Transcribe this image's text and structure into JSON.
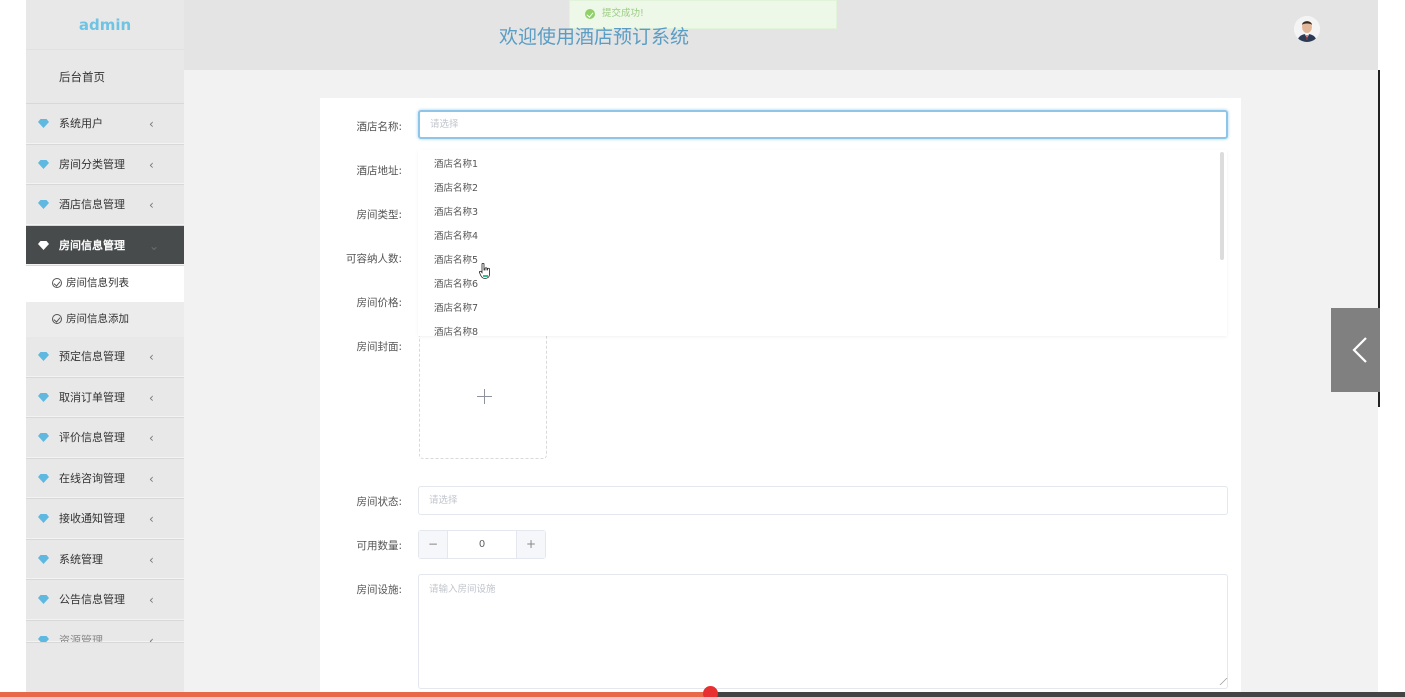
{
  "sidebar": {
    "brand": "admin",
    "home": "后台首页",
    "items": [
      {
        "label": "系统用户",
        "icon": "gem-icon"
      },
      {
        "label": "房间分类管理",
        "icon": "gem-icon"
      },
      {
        "label": "酒店信息管理",
        "icon": "gem-icon"
      },
      {
        "label": "房间信息管理",
        "icon": "gem-icon",
        "active": true
      },
      {
        "label": "预定信息管理",
        "icon": "gem-icon"
      },
      {
        "label": "取消订单管理",
        "icon": "gem-icon"
      },
      {
        "label": "评价信息管理",
        "icon": "gem-icon"
      },
      {
        "label": "在线咨询管理",
        "icon": "gem-icon"
      },
      {
        "label": "接收通知管理",
        "icon": "gem-icon"
      },
      {
        "label": "系统管理",
        "icon": "gem-icon"
      },
      {
        "label": "公告信息管理",
        "icon": "gem-icon"
      },
      {
        "label": "资源管理",
        "icon": "gem-icon"
      }
    ],
    "subitems": [
      "房间信息列表",
      "房间信息添加"
    ]
  },
  "header": {
    "title": "欢迎使用酒店预订系统",
    "toast": "提交成功!"
  },
  "form": {
    "hotel_name_label": "酒店名称:",
    "hotel_name_placeholder": "请选择",
    "hotel_address_label": "酒店地址:",
    "room_type_label": "房间类型:",
    "capacity_label": "可容纳人数:",
    "price_label": "房间价格:",
    "cover_label": "房间封面:",
    "status_label": "房间状态:",
    "status_placeholder": "请选择",
    "count_label": "可用数量:",
    "count_value": "0",
    "count_minus": "−",
    "count_plus": "+",
    "facilities_label": "房间设施:",
    "facilities_placeholder": "请输入房间设施"
  },
  "dropdown": {
    "options": [
      "酒店名称1",
      "酒店名称2",
      "酒店名称3",
      "酒店名称4",
      "酒店名称5",
      "酒店名称6",
      "酒店名称7",
      "酒店名称8"
    ]
  },
  "colors": {
    "brand": "#6fc3e3",
    "title": "#5a9dc4",
    "active_menu": "#474b4c",
    "gem": "#5fb8e0",
    "focus_border": "#8ec5e8",
    "progress": "#e8684a"
  },
  "progress": {
    "played_fraction": 0.506
  }
}
